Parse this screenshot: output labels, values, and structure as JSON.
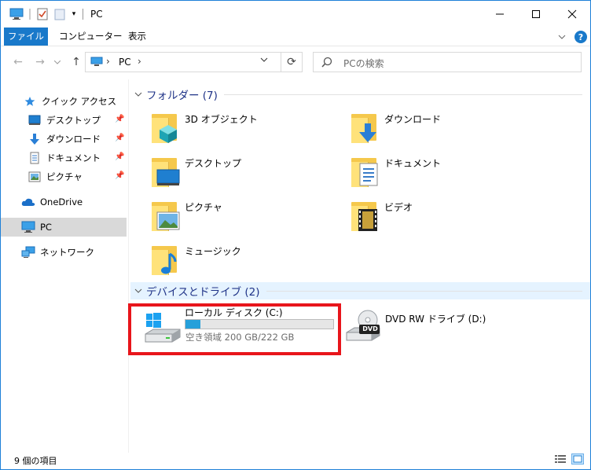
{
  "window": {
    "title": "PC"
  },
  "ribbon": {
    "tabs": [
      "ファイル",
      "コンピューター",
      "表示"
    ]
  },
  "address": {
    "location": "PC"
  },
  "search": {
    "placeholder": "PCの検索"
  },
  "sidebar": {
    "items": [
      {
        "label": "クイック アクセス",
        "icon": "star-icon"
      },
      {
        "label": "デスクトップ",
        "icon": "desktop-icon",
        "pinned": true
      },
      {
        "label": "ダウンロード",
        "icon": "download-icon",
        "pinned": true
      },
      {
        "label": "ドキュメント",
        "icon": "document-icon",
        "pinned": true
      },
      {
        "label": "ピクチャ",
        "icon": "picture-icon",
        "pinned": true
      },
      {
        "label": "OneDrive",
        "icon": "cloud-icon"
      },
      {
        "label": "PC",
        "icon": "pc-icon",
        "selected": true
      },
      {
        "label": "ネットワーク",
        "icon": "network-icon"
      }
    ]
  },
  "folders_group": {
    "title": "フォルダー (7)"
  },
  "folders": [
    {
      "label": "3D オブジェクト",
      "icon": "3d-objects-icon"
    },
    {
      "label": "ダウンロード",
      "icon": "download-folder-icon"
    },
    {
      "label": "デスクトップ",
      "icon": "desktop-folder-icon"
    },
    {
      "label": "ドキュメント",
      "icon": "documents-folder-icon"
    },
    {
      "label": "ピクチャ",
      "icon": "pictures-folder-icon"
    },
    {
      "label": "ビデオ",
      "icon": "videos-folder-icon"
    },
    {
      "label": "ミュージック",
      "icon": "music-folder-icon"
    }
  ],
  "devices_group": {
    "title": "デバイスとドライブ (2)"
  },
  "drives": [
    {
      "label": "ローカル ディスク (C:)",
      "free_text": "空き領域 200 GB/222 GB",
      "used_fraction": 0.099
    },
    {
      "label": "DVD RW ドライブ (D:)",
      "badge": "DVD"
    }
  ],
  "status": {
    "item_count": "9 個の項目"
  },
  "colors": {
    "accent": "#1979ca",
    "highlight": "#e8151b",
    "usage_bar": "#26a0da"
  }
}
